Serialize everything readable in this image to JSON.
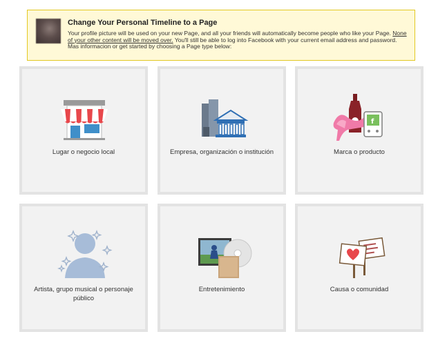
{
  "notice": {
    "title": "Change Your Personal Timeline to a Page",
    "line1": "Your profile picture will be used on your new Page, and all your friends will automatically become people who like your Page.",
    "link": "None of your other content will be moved over.",
    "line2": "You'll still be able to log into Facebook with your current email address and password.",
    "line3": "Mas informacion or get started by choosing a Page type below:"
  },
  "categories": [
    {
      "label": "Lugar o negocio local",
      "icon": "storefront-icon"
    },
    {
      "label": "Empresa, organización o institución",
      "icon": "building-icon"
    },
    {
      "label": "Marca o producto",
      "icon": "brand-products-icon"
    },
    {
      "label": "Artista, grupo musical o personaje público",
      "icon": "person-silhouette-icon"
    },
    {
      "label": "Entretenimiento",
      "icon": "media-icon"
    },
    {
      "label": "Causa o comunidad",
      "icon": "protest-signs-icon"
    }
  ],
  "colors": {
    "notice_bg": "#fff9d7",
    "notice_border": "#e2c822",
    "tile_bg": "#f2f2f2",
    "tile_border": "#e3e3e3"
  }
}
